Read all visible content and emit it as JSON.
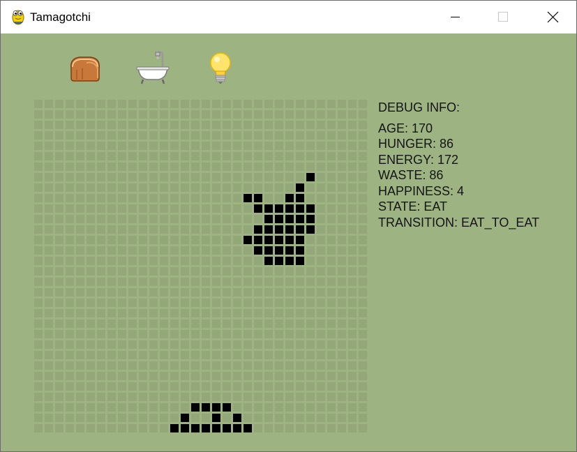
{
  "window": {
    "title": "Tamagotchi",
    "app_icon": "pygame-snake-icon",
    "controls": [
      "minimize-icon",
      "maximize-icon",
      "close-icon"
    ]
  },
  "toolbar": [
    {
      "name": "feed-button",
      "icon": "bread-icon"
    },
    {
      "name": "clean-button",
      "icon": "bathtub-icon"
    },
    {
      "name": "light-button",
      "icon": "lightbulb-icon"
    }
  ],
  "debug": {
    "title": "DEBUG INFO:",
    "lines": [
      "AGE: 170",
      "HUNGER: 86",
      "ENERGY: 172",
      "WASTE: 86",
      "HAPPINESS: 4",
      "STATE: EAT",
      "TRANSITION: EAT_TO_EAT"
    ]
  },
  "colors": {
    "background": "#9eb382",
    "pixel_off": "#93a779",
    "pixel_on": "#000000",
    "text": "#141414"
  },
  "lcd": {
    "columns": 32,
    "rows": 32,
    "sprites": [
      {
        "name": "apple-sprite",
        "pixels": [
          [
            26,
            7
          ],
          [
            25,
            8
          ],
          [
            20,
            9
          ],
          [
            21,
            9
          ],
          [
            24,
            9
          ],
          [
            25,
            9
          ],
          [
            21,
            10
          ],
          [
            22,
            10
          ],
          [
            23,
            10
          ],
          [
            24,
            10
          ],
          [
            25,
            10
          ],
          [
            26,
            10
          ],
          [
            22,
            11
          ],
          [
            23,
            11
          ],
          [
            24,
            11
          ],
          [
            25,
            11
          ],
          [
            26,
            11
          ],
          [
            21,
            12
          ],
          [
            22,
            12
          ],
          [
            23,
            12
          ],
          [
            24,
            12
          ],
          [
            25,
            12
          ],
          [
            26,
            12
          ],
          [
            20,
            13
          ],
          [
            21,
            13
          ],
          [
            22,
            13
          ],
          [
            23,
            13
          ],
          [
            24,
            13
          ],
          [
            25,
            13
          ],
          [
            21,
            14
          ],
          [
            22,
            14
          ],
          [
            23,
            14
          ],
          [
            24,
            14
          ],
          [
            25,
            14
          ],
          [
            22,
            15
          ],
          [
            23,
            15
          ],
          [
            24,
            15
          ],
          [
            25,
            15
          ]
        ]
      },
      {
        "name": "pet-sprite",
        "pixels": [
          [
            15,
            29
          ],
          [
            16,
            29
          ],
          [
            17,
            29
          ],
          [
            18,
            29
          ],
          [
            14,
            30
          ],
          [
            17,
            30
          ],
          [
            19,
            30
          ],
          [
            13,
            31
          ],
          [
            14,
            31
          ],
          [
            15,
            31
          ],
          [
            16,
            31
          ],
          [
            17,
            31
          ],
          [
            18,
            31
          ],
          [
            19,
            31
          ],
          [
            20,
            31
          ]
        ]
      }
    ]
  }
}
